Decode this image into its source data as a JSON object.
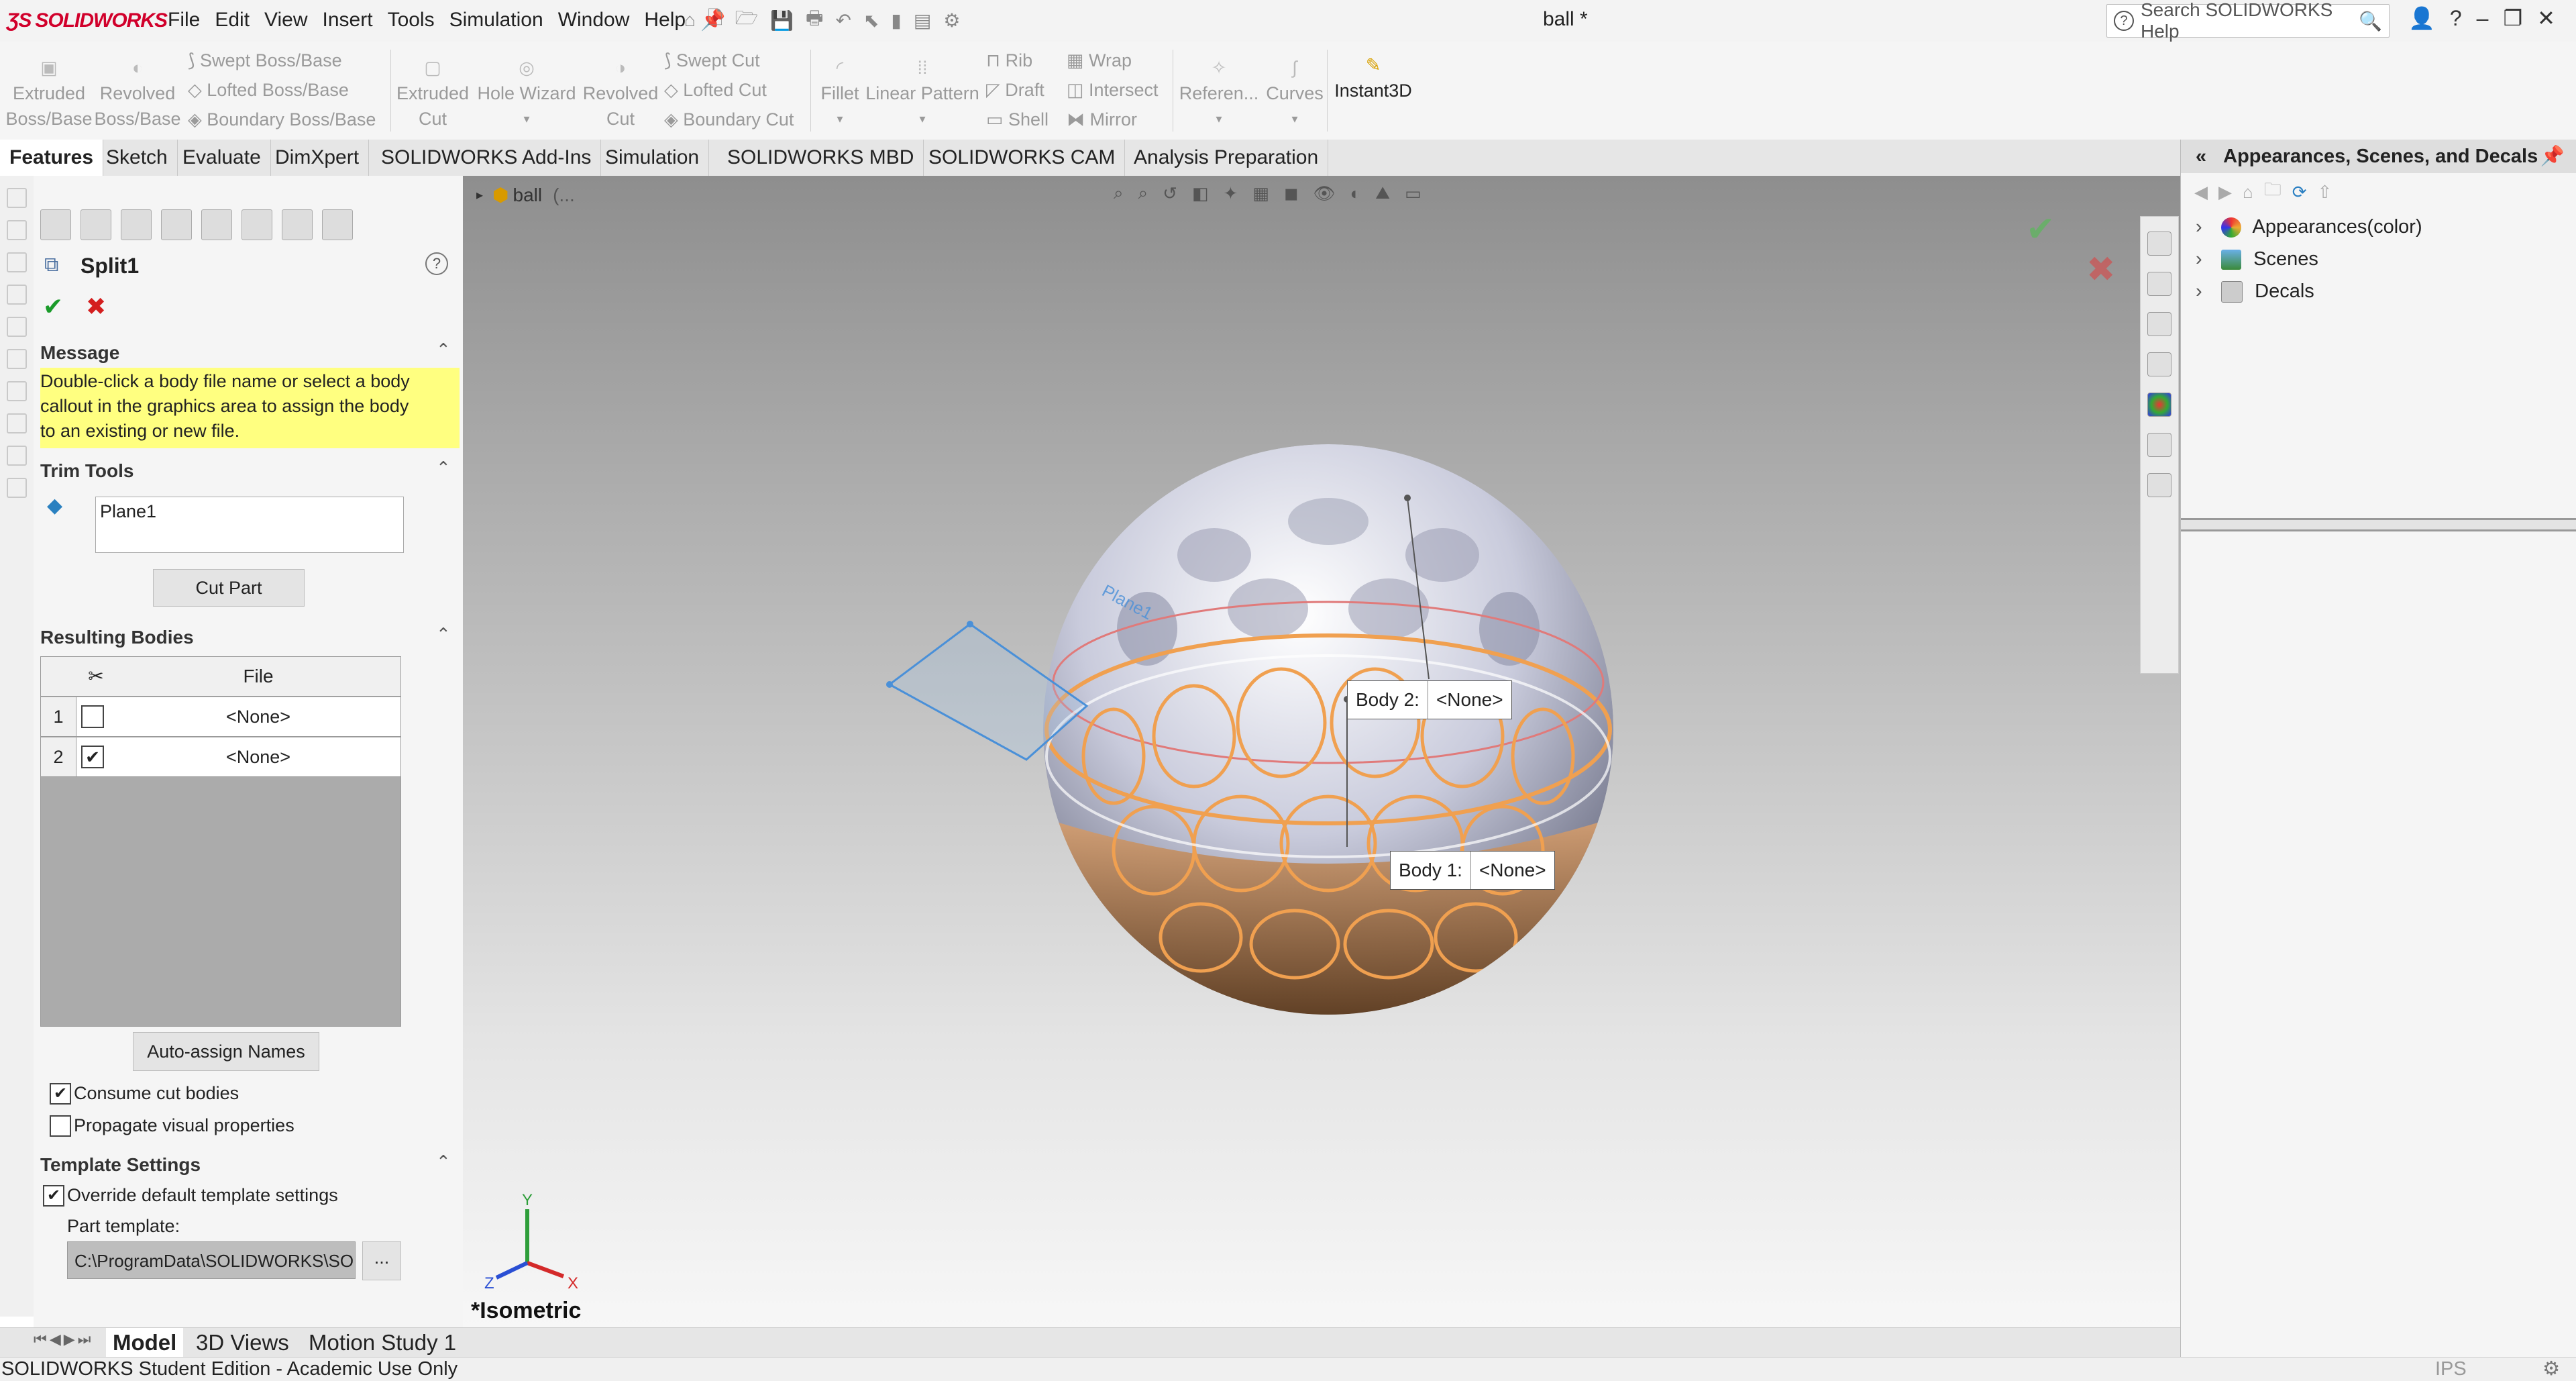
{
  "app": {
    "logo_text": "SOLIDWORKS",
    "document_title": "ball *",
    "menu": [
      "File",
      "Edit",
      "View",
      "Insert",
      "Tools",
      "Simulation",
      "Window",
      "Help"
    ],
    "help_search_placeholder": "Search SOLIDWORKS Help",
    "window_controls": [
      "?",
      "–",
      "❐",
      "✕"
    ]
  },
  "command_manager": {
    "extruded_boss": [
      "Extruded",
      "Boss/Base"
    ],
    "revolved_boss": [
      "Revolved",
      "Boss/Base"
    ],
    "swept_boss": "Swept Boss/Base",
    "lofted_boss": "Lofted Boss/Base",
    "boundary_boss": "Boundary Boss/Base",
    "extruded_cut": [
      "Extruded",
      "Cut"
    ],
    "hole_wizard": "Hole Wizard",
    "revolved_cut": [
      "Revolved",
      "Cut"
    ],
    "swept_cut": "Swept Cut",
    "lofted_cut": "Lofted Cut",
    "boundary_cut": "Boundary Cut",
    "fillet": "Fillet",
    "linear_pattern": "Linear Pattern",
    "rib": "Rib",
    "wrap": "Wrap",
    "draft": "Draft",
    "intersect": "Intersect",
    "shell": "Shell",
    "mirror": "Mirror",
    "reference": "Referen...",
    "curves": "Curves",
    "instant3d": "Instant3D"
  },
  "tabs": [
    "Features",
    "Sketch",
    "Evaluate",
    "DimXpert",
    "SOLIDWORKS Add-Ins",
    "Simulation",
    "SOLIDWORKS MBD",
    "SOLIDWORKS CAM",
    "Analysis Preparation"
  ],
  "property_manager": {
    "title": "Split1",
    "message_header": "Message",
    "message_lines": [
      "Double-click a body file name or select a body",
      "callout in the graphics area to assign the body",
      "to an existing or new file."
    ],
    "trim_tools_header": "Trim Tools",
    "trim_tool_value": "Plane1",
    "cut_part_label": "Cut Part",
    "resulting_bodies_header": "Resulting Bodies",
    "file_column": "File",
    "rows": [
      {
        "num": "1",
        "file": "<None>"
      },
      {
        "num": "2",
        "file": "<None>"
      }
    ],
    "auto_assign_label": "Auto-assign Names",
    "consume_cut_label": "Consume cut bodies",
    "propagate_label": "Propagate visual properties",
    "template_header": "Template Settings",
    "override_label": "Override default template settings",
    "part_template_label": "Part template:",
    "part_template_path": "C:\\ProgramData\\SOLIDWORKS\\SOL",
    "browse_label": "..."
  },
  "viewport": {
    "tree_root": "ball",
    "tree_root_suffix": "(...",
    "plane_label": "Plane1",
    "body2_label": "Body  2:",
    "body2_value": "<None>",
    "body1_label": "Body  1:",
    "body1_value": "<None>",
    "view_name": "*Isometric",
    "triad": {
      "x": "X",
      "y": "Y",
      "z": "Z"
    }
  },
  "right_panel": {
    "title": "Appearances, Scenes, and Decals",
    "items": [
      "Appearances(color)",
      "Scenes",
      "Decals"
    ]
  },
  "bottom_tabs": [
    "Model",
    "3D Views",
    "Motion Study 1"
  ],
  "status_bar": {
    "text": "SOLIDWORKS Student Edition - Academic Use Only",
    "units": "IPS"
  },
  "colors": {
    "accent": "#d1002b",
    "message_bg": "#ffff80",
    "selection_orange": "#f0a050"
  }
}
